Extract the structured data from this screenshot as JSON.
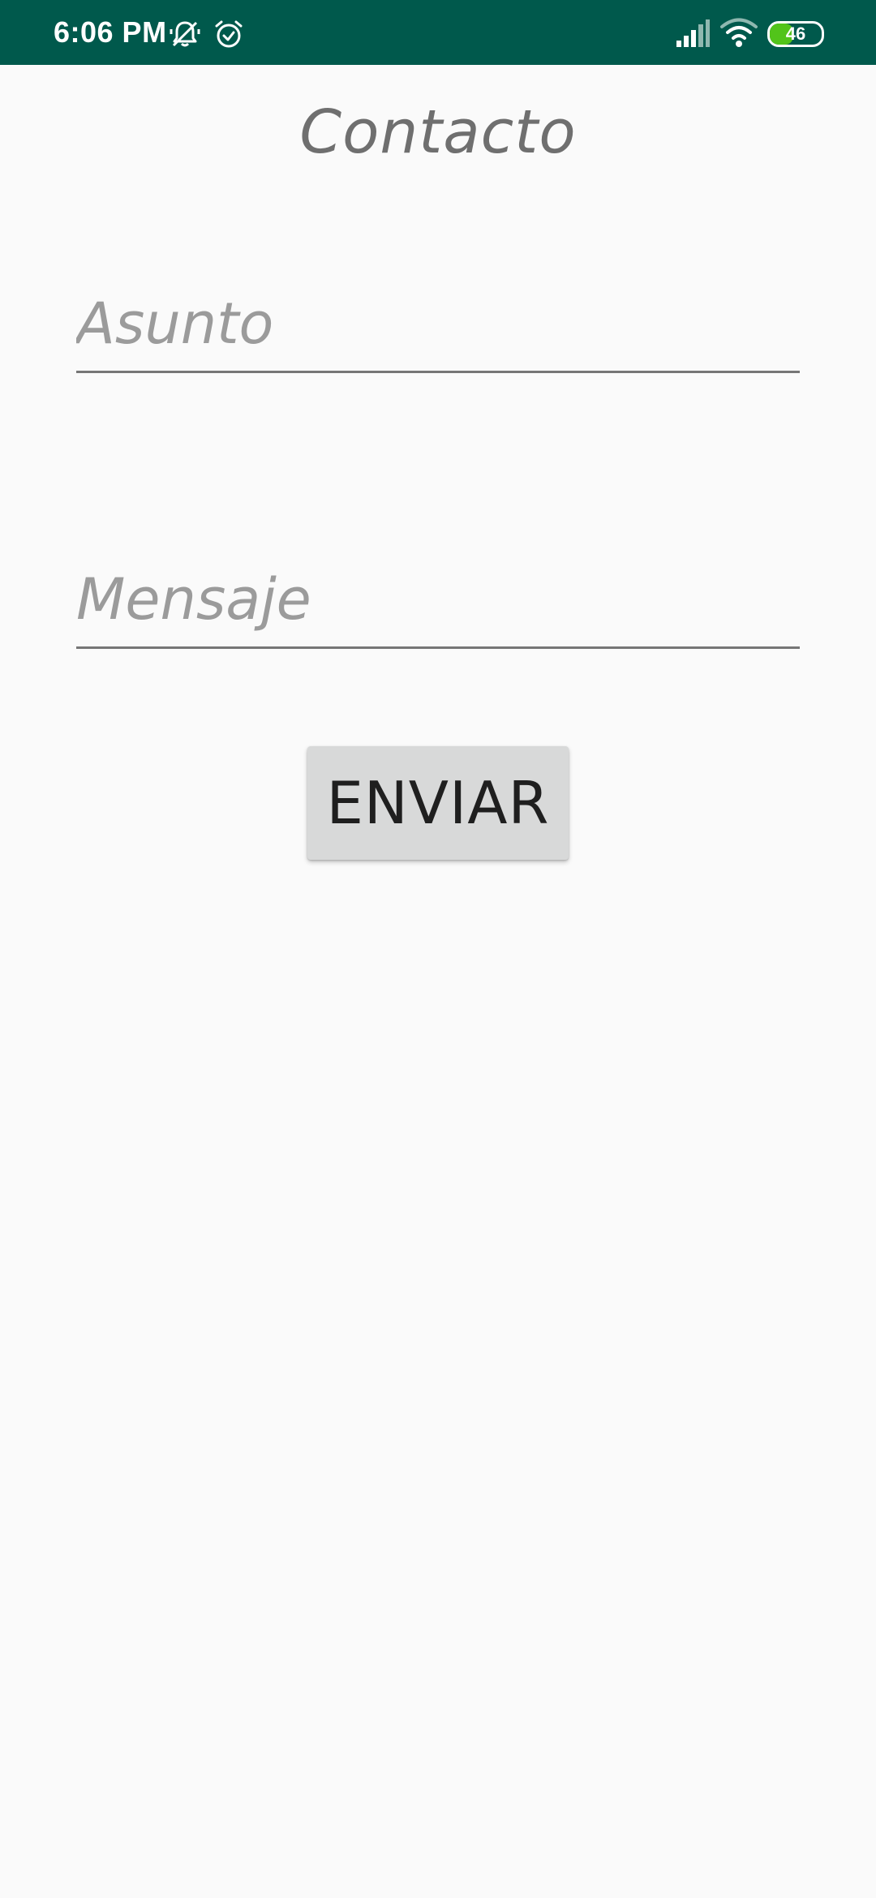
{
  "status_bar": {
    "time": "6:06 PM",
    "icons": [
      "bell-off-icon",
      "alarm-icon",
      "signal-icon",
      "wifi-icon",
      "battery-icon"
    ],
    "battery_level": "46",
    "battery_fraction": 0.46,
    "background_color": "#00594c",
    "battery_color": "#52c41a"
  },
  "page": {
    "title": "Contacto"
  },
  "form": {
    "asunto": {
      "value": "",
      "placeholder": "Asunto"
    },
    "mensaje": {
      "value": "",
      "placeholder": "Mensaje"
    },
    "send_label": "ENVIAR"
  },
  "colors": {
    "background": "#fafafa",
    "button": "#d8d9d9",
    "underline": "#767676",
    "title_text": "#6f6f6f",
    "placeholder_text": "#9b9b9b"
  }
}
